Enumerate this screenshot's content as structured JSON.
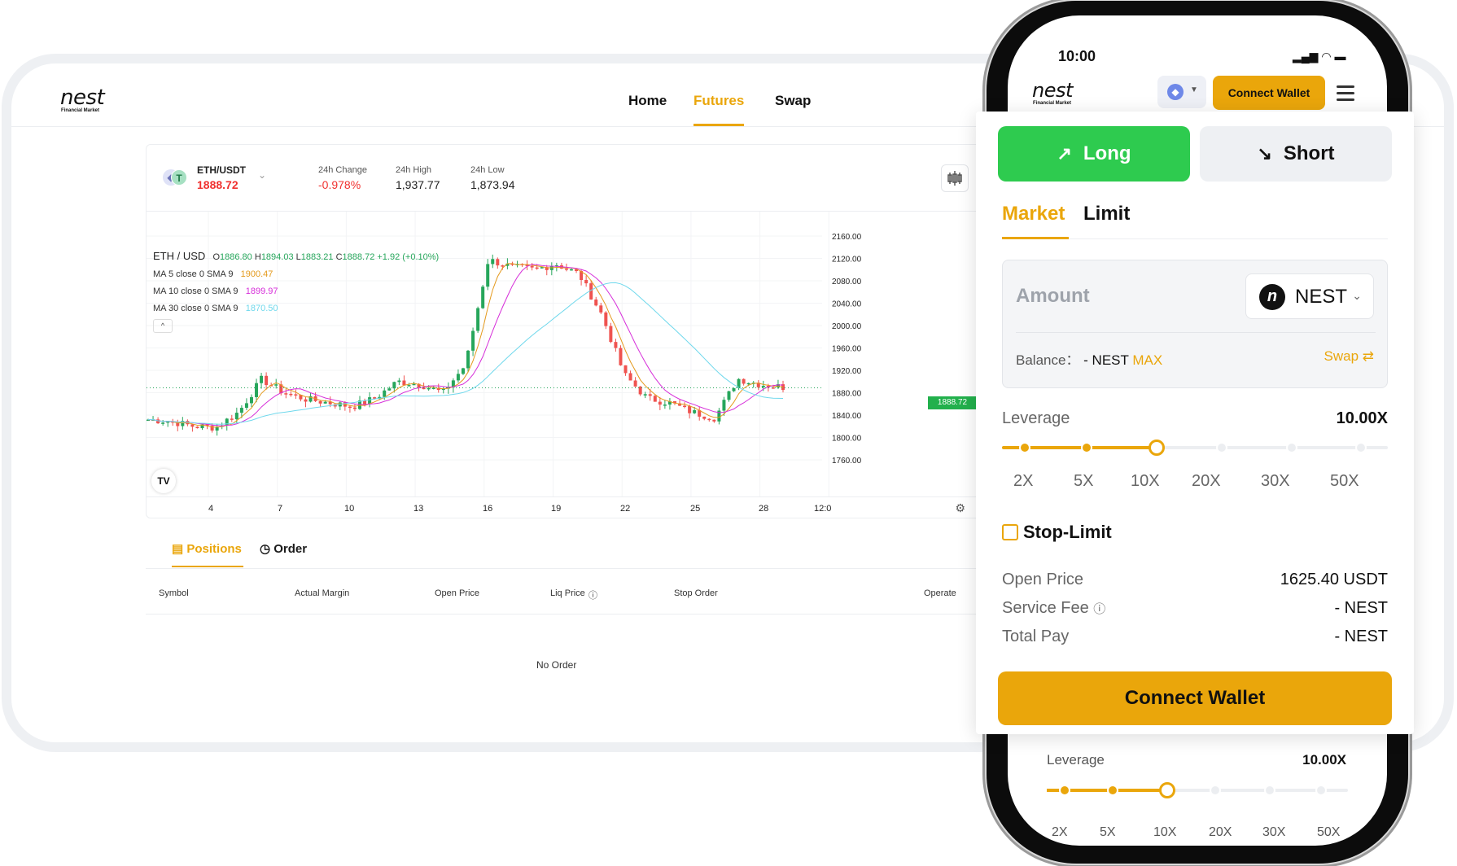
{
  "desktop": {
    "logo": {
      "word": "nest",
      "sub": "Financial Market"
    },
    "nav": {
      "home": "Home",
      "futures": "Futures",
      "swap": "Swap"
    },
    "ticker": {
      "pair": "ETH/USDT",
      "price": "1888.72",
      "change_label": "24h Change",
      "change_value": "-0.978%",
      "high_label": "24h High",
      "high_value": "1,937.77",
      "low_label": "24h Low",
      "low_value": "1,873.94"
    },
    "chart_legend": {
      "symbol": "ETH / USD",
      "o": "O",
      "o_val": "1886.80",
      "h": "H",
      "h_val": "1894.03",
      "l": "L",
      "l_val": "1883.21",
      "c": "C",
      "c_val": "1888.72",
      "chg": "+1.92 (+0.10%)",
      "ma5_label": "MA 5 close 0 SMA 9",
      "ma5_val": "1900.47",
      "ma10_label": "MA 10 close 0 SMA 9",
      "ma10_val": "1899.97",
      "ma30_label": "MA 30 close 0 SMA 9",
      "ma30_val": "1870.50",
      "collapse": "^",
      "tv": "TV",
      "gear": "⚙",
      "last_price_tag": "1888.72"
    },
    "positions": {
      "tab_positions": "Positions",
      "tab_order": "Order",
      "columns": [
        "Symbol",
        "Actual Margin",
        "Open Price",
        "Liq Price",
        "Stop Order",
        "Operate"
      ],
      "empty": "No Order"
    }
  },
  "chart_data": {
    "type": "candlestick",
    "symbol": "ETH / USD",
    "y_ticks": [
      "2160.00",
      "2120.00",
      "2080.00",
      "2040.00",
      "2000.00",
      "1960.00",
      "1920.00",
      "1880.00",
      "1840.00",
      "1800.00",
      "1760.00"
    ],
    "x_ticks": [
      "4",
      "7",
      "10",
      "13",
      "16",
      "19",
      "22",
      "25",
      "28",
      "12:0"
    ],
    "ylim": [
      1760,
      2160
    ],
    "last_price": 1888.72,
    "ma_series": [
      {
        "name": "MA 5",
        "color": "#e49a1d"
      },
      {
        "name": "MA 10",
        "color": "#d62ed9"
      },
      {
        "name": "MA 30",
        "color": "#6fd8ec"
      }
    ],
    "close_path": [
      [
        1,
        1832
      ],
      [
        2,
        1829
      ],
      [
        3,
        1820
      ],
      [
        4,
        1818
      ],
      [
        5,
        1846
      ],
      [
        6,
        1904
      ],
      [
        7,
        1880
      ],
      [
        8,
        1868
      ],
      [
        9,
        1862
      ],
      [
        10,
        1855
      ],
      [
        11,
        1870
      ],
      [
        12,
        1900
      ],
      [
        13,
        1895
      ],
      [
        14,
        1880
      ],
      [
        15,
        1930
      ],
      [
        16,
        2118
      ],
      [
        17,
        2105
      ],
      [
        18,
        2100
      ],
      [
        19,
        2110
      ],
      [
        20,
        2092
      ],
      [
        21,
        2020
      ],
      [
        22,
        1912
      ],
      [
        23,
        1870
      ],
      [
        24,
        1862
      ],
      [
        25,
        1845
      ],
      [
        26,
        1835
      ],
      [
        27,
        1905
      ],
      [
        28,
        1895
      ],
      [
        29,
        1890
      ]
    ],
    "colors": {
      "up": "#26a65b",
      "down": "#ef5350"
    }
  },
  "phone": {
    "time": "10:00",
    "status_icons": "▂▄▆ ◠ ▬",
    "logo": {
      "word": "nest",
      "sub": "Financial Market"
    },
    "eth_icon": "◆",
    "caret": "▼",
    "connect": "Connect Wallet",
    "leverage_label": "Leverage",
    "leverage_value": "10.00X",
    "ticks": [
      "2X",
      "5X",
      "10X",
      "20X",
      "30X",
      "50X"
    ]
  },
  "panel": {
    "long": "Long",
    "short": "Short",
    "long_icon": "↗",
    "short_icon": "↘",
    "tab_market": "Market",
    "tab_limit": "Limit",
    "amount_placeholder": "Amount",
    "token": "NEST",
    "token_logo": "n",
    "token_caret": "⌄",
    "balance_label": "Balance：",
    "balance_value": "- NEST",
    "max": "MAX",
    "swap": "Swap ⇄",
    "leverage_label": "Leverage",
    "leverage_value": "10.00X",
    "leverage_level": 0.4,
    "ticks": [
      "2X",
      "5X",
      "10X",
      "20X",
      "30X",
      "50X"
    ],
    "stop_limit": "Stop-Limit",
    "open_price_label": "Open Price",
    "open_price_value": "1625.40 USDT",
    "service_fee_label": "Service Fee",
    "service_fee_value": "- NEST",
    "total_pay_label": "Total Pay",
    "total_pay_value": "- NEST",
    "connect": "Connect Wallet",
    "accent": "#EAA60B",
    "long_color": "#2ecb4f"
  }
}
